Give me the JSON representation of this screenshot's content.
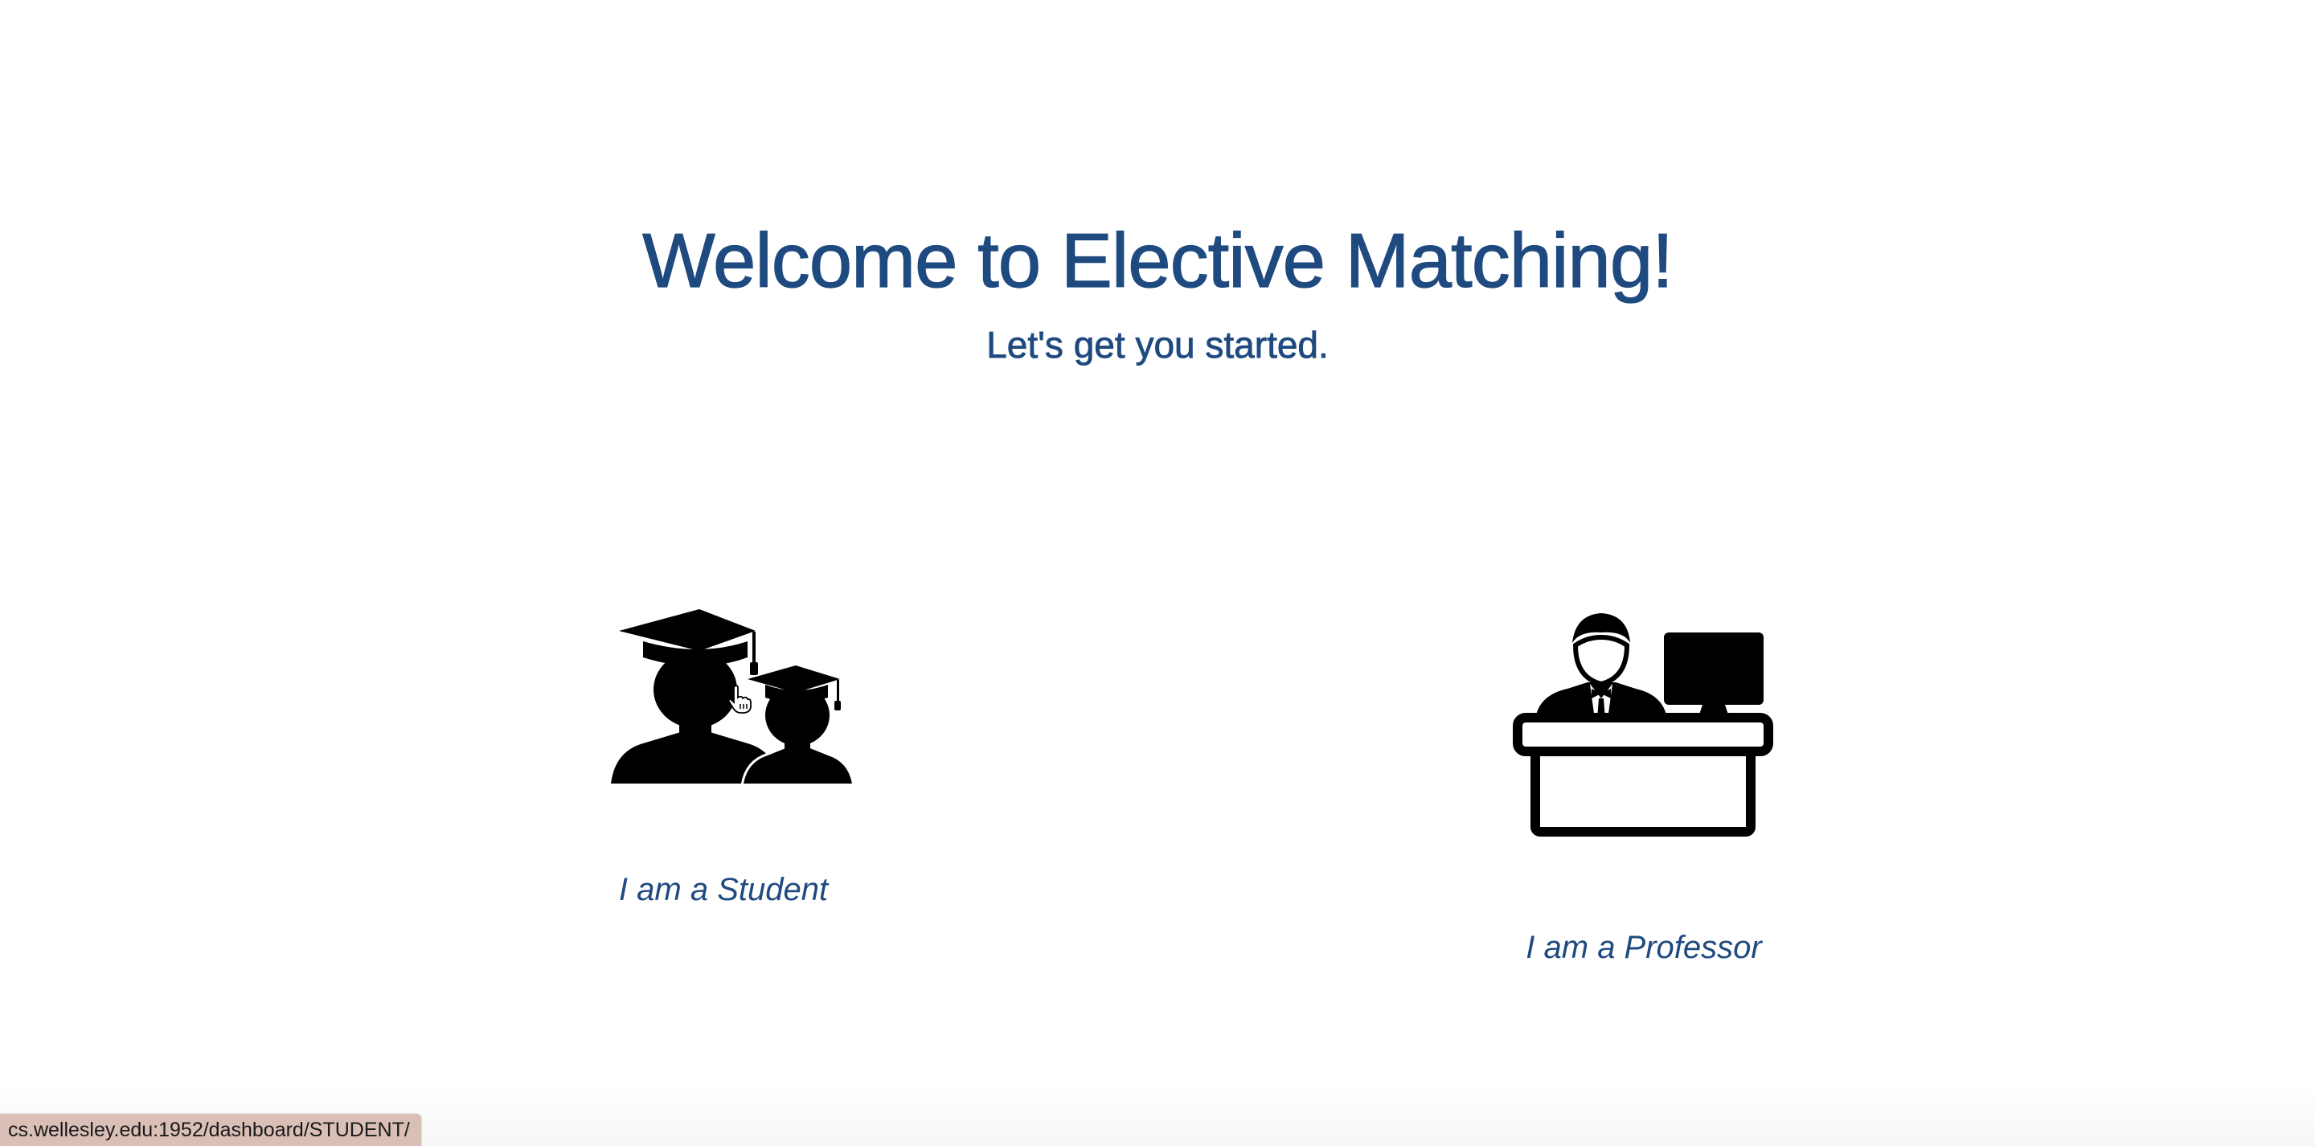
{
  "header": {
    "title": "Welcome to Elective Matching!",
    "subtitle": "Let's get you started."
  },
  "roles": {
    "student": {
      "label": "I am a Student",
      "icon": "graduates-icon"
    },
    "professor": {
      "label": "I am a Professor",
      "icon": "professor-desk-icon"
    }
  },
  "status_bar": {
    "url": "cs.wellesley.edu:1952/dashboard/STUDENT/"
  },
  "colors": {
    "accent": "#1f4a80",
    "status_bar_bg": "#d9bfb6"
  }
}
